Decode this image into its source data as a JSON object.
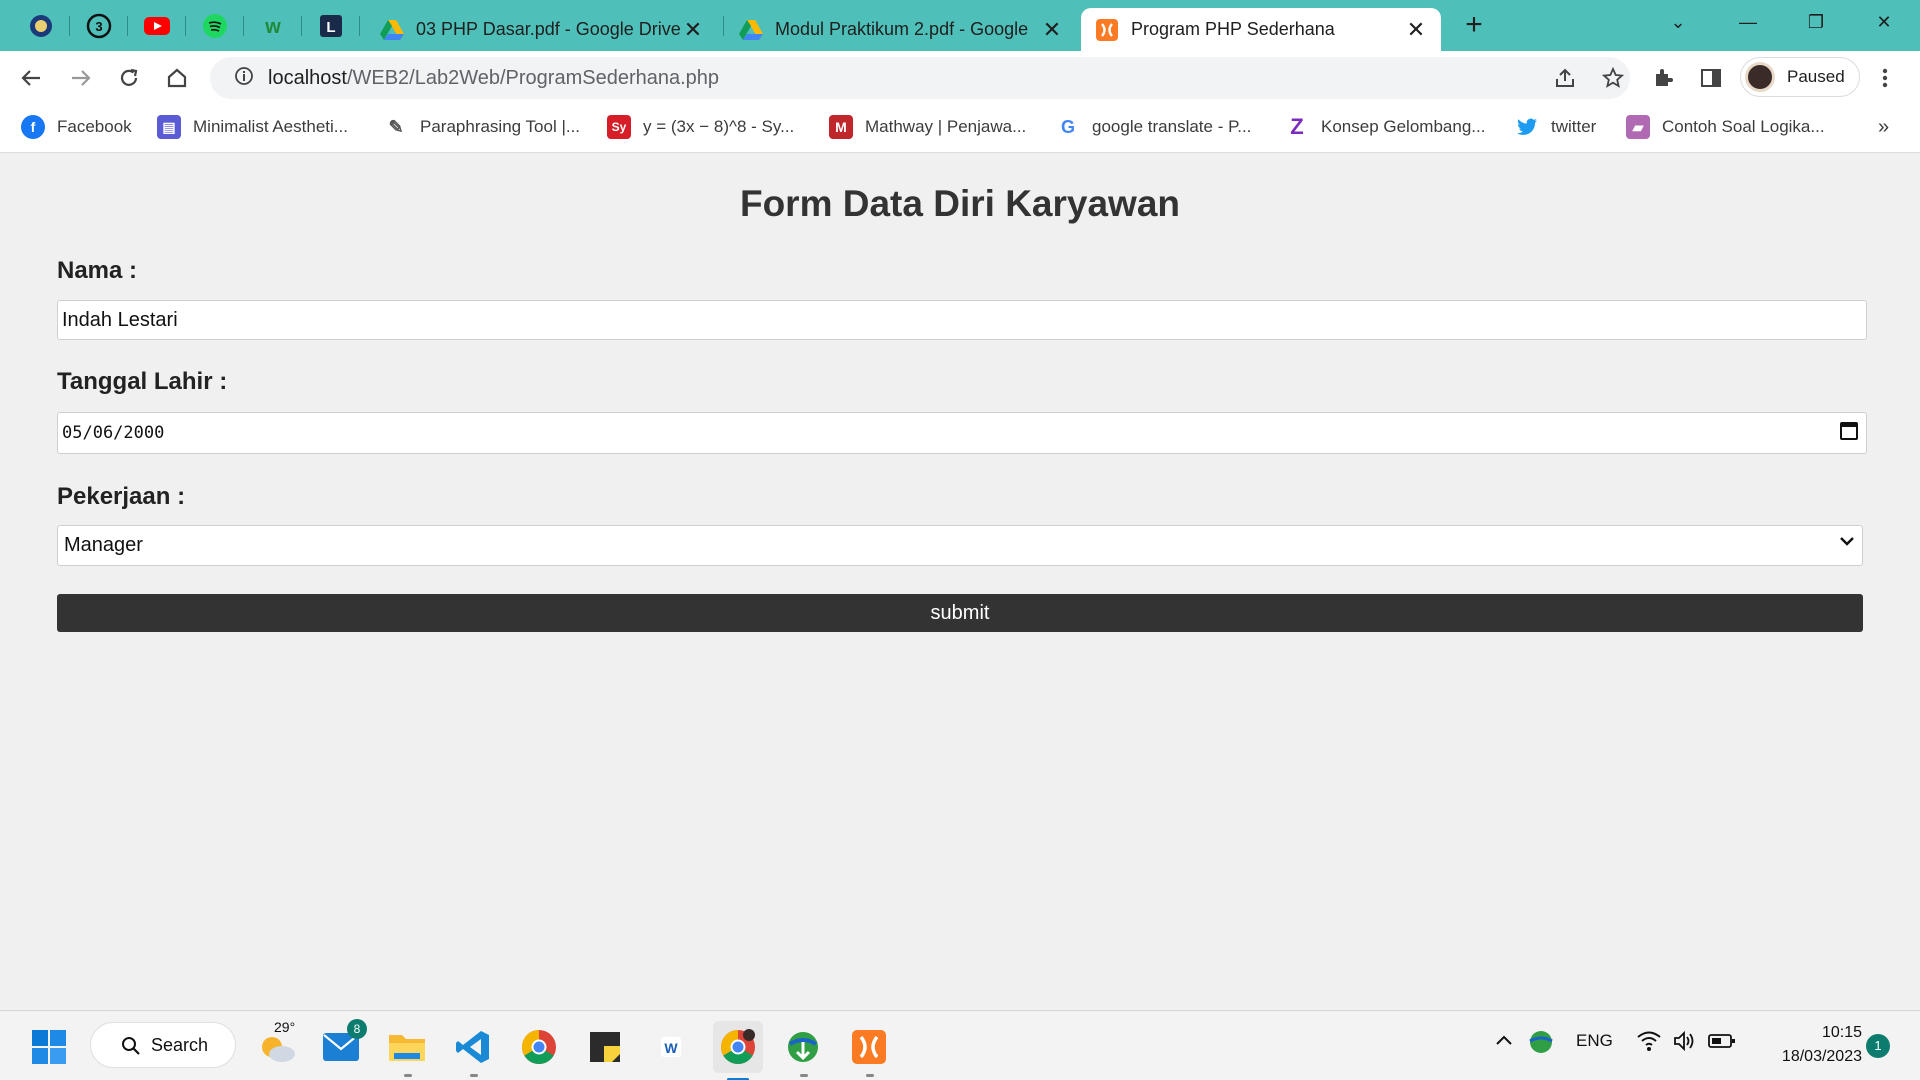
{
  "browser": {
    "tabs": [
      {
        "title": "03 PHP Dasar.pdf - Google Drive",
        "icon": "google-drive-icon"
      },
      {
        "title": "Modul Praktikum 2.pdf - Google",
        "icon": "google-drive-icon"
      },
      {
        "title": "Program PHP Sederhana",
        "icon": "xampp-icon",
        "active": true
      }
    ],
    "pinned_tabs": [
      "site-logo-icon",
      "whatsapp-icon",
      "youtube-icon",
      "spotify-icon",
      "wattpad-icon",
      "letterboxd-icon"
    ],
    "url_host": "localhost",
    "url_path": "/WEB2/Lab2Web/ProgramSederhana.php",
    "profile_status": "Paused"
  },
  "bookmarks": [
    {
      "label": "Facebook",
      "icon": "facebook-icon",
      "color": "#1877f2"
    },
    {
      "label": "Minimalist Aestheti...",
      "icon": "canva-icon",
      "color": "#5b5bd6"
    },
    {
      "label": "Paraphrasing Tool |...",
      "icon": "quill-icon",
      "color": "#555555"
    },
    {
      "label": "y = (3x − 8)^8 - Sy...",
      "icon": "symbolab-icon",
      "color": "#d71e28"
    },
    {
      "label": "Mathway | Penjawa...",
      "icon": "mathway-icon",
      "color": "#c0272d"
    },
    {
      "label": "google translate - P...",
      "icon": "google-icon",
      "color": "#4285f4"
    },
    {
      "label": "Konsep Gelombang...",
      "icon": "zenius-icon",
      "color": "#7b2cbf"
    },
    {
      "label": "twitter",
      "icon": "twitter-icon",
      "color": "#1d9bf0"
    },
    {
      "label": "Contoh Soal Logika...",
      "icon": "book-icon",
      "color": "#b06ab3"
    }
  ],
  "form": {
    "title": "Form Data Diri Karyawan",
    "nama_label": "Nama :",
    "nama_value": "Indah Lestari",
    "tanggal_label": "Tanggal Lahir :",
    "tanggal_value": "05/06/2000",
    "pekerjaan_label": "Pekerjaan :",
    "pekerjaan_value": "Manager",
    "submit_label": "submit"
  },
  "taskbar": {
    "search_label": "Search",
    "weather_temp": "29°",
    "mail_badge": "8",
    "language": "ENG",
    "time": "10:15",
    "date": "18/03/2023",
    "notification_count": "1"
  }
}
